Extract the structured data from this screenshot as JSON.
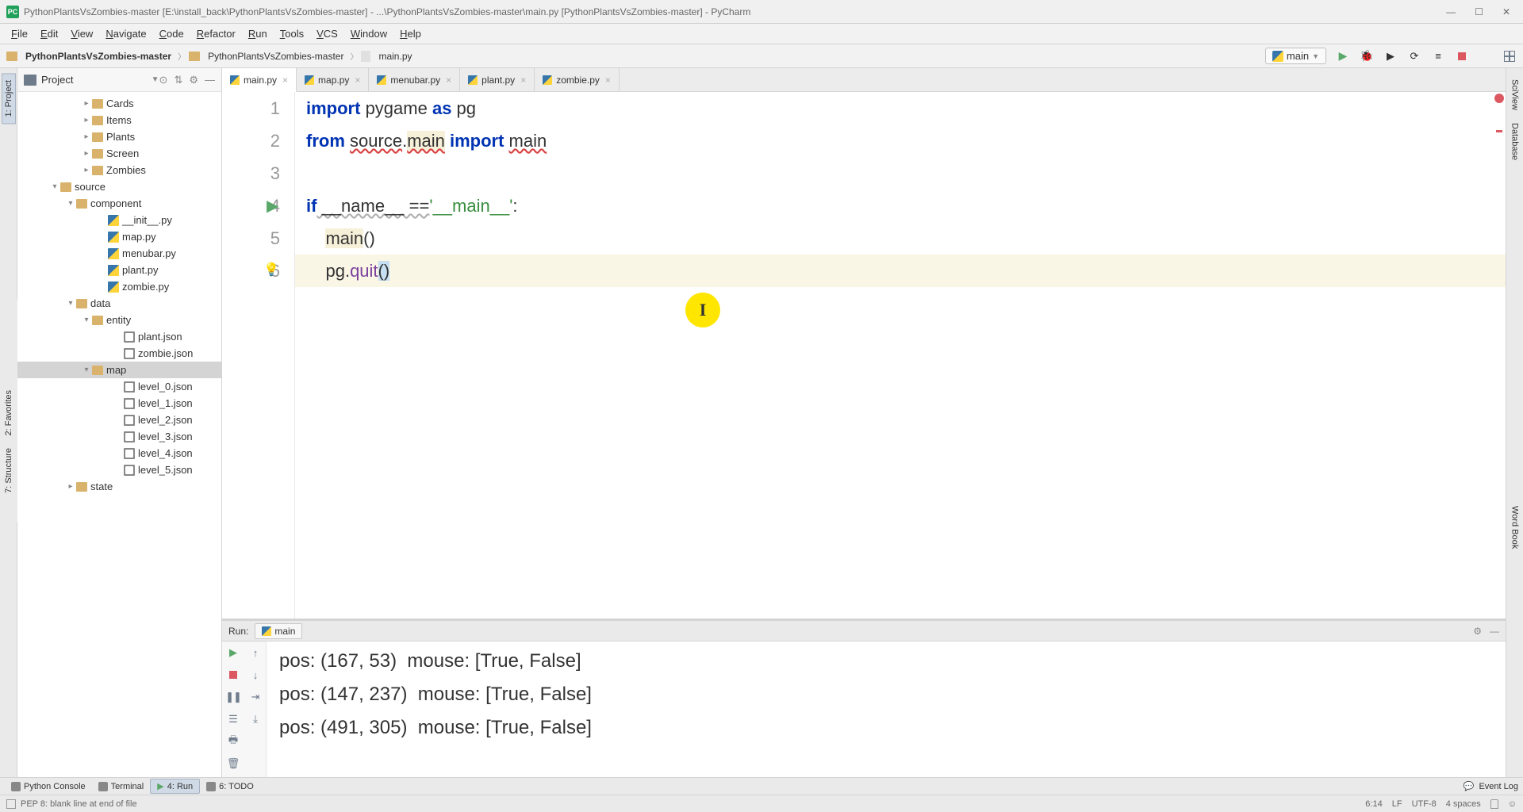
{
  "window": {
    "title": "PythonPlantsVsZombies-master [E:\\install_back\\PythonPlantsVsZombies-master] - ...\\PythonPlantsVsZombies-master\\main.py [PythonPlantsVsZombies-master] - PyCharm"
  },
  "menu": {
    "items": [
      "File",
      "Edit",
      "View",
      "Navigate",
      "Code",
      "Refactor",
      "Run",
      "Tools",
      "VCS",
      "Window",
      "Help"
    ]
  },
  "breadcrumb": {
    "root": "PythonPlantsVsZombies-master",
    "mid": "PythonPlantsVsZombies-master",
    "file": "main.py"
  },
  "run_config": {
    "name": "main"
  },
  "project_panel": {
    "title": "Project"
  },
  "tree": {
    "items": [
      {
        "depth": 4,
        "kind": "folder",
        "expand": "▸",
        "label": "Cards"
      },
      {
        "depth": 4,
        "kind": "folder",
        "expand": "▸",
        "label": "Items"
      },
      {
        "depth": 4,
        "kind": "folder",
        "expand": "▸",
        "label": "Plants"
      },
      {
        "depth": 4,
        "kind": "folder",
        "expand": "▸",
        "label": "Screen"
      },
      {
        "depth": 4,
        "kind": "folder",
        "expand": "▸",
        "label": "Zombies"
      },
      {
        "depth": 2,
        "kind": "folder",
        "expand": "▾",
        "label": "source"
      },
      {
        "depth": 3,
        "kind": "folder",
        "expand": "▾",
        "label": "component"
      },
      {
        "depth": 5,
        "kind": "py",
        "expand": "",
        "label": "__init__.py"
      },
      {
        "depth": 5,
        "kind": "py",
        "expand": "",
        "label": "map.py"
      },
      {
        "depth": 5,
        "kind": "py",
        "expand": "",
        "label": "menubar.py"
      },
      {
        "depth": 5,
        "kind": "py",
        "expand": "",
        "label": "plant.py"
      },
      {
        "depth": 5,
        "kind": "py",
        "expand": "",
        "label": "zombie.py"
      },
      {
        "depth": 3,
        "kind": "folder",
        "expand": "▾",
        "label": "data"
      },
      {
        "depth": 4,
        "kind": "folder",
        "expand": "▾",
        "label": "entity"
      },
      {
        "depth": 6,
        "kind": "json",
        "expand": "",
        "label": "plant.json"
      },
      {
        "depth": 6,
        "kind": "json",
        "expand": "",
        "label": "zombie.json"
      },
      {
        "depth": 4,
        "kind": "folder",
        "expand": "▾",
        "label": "map",
        "selected": true
      },
      {
        "depth": 6,
        "kind": "json",
        "expand": "",
        "label": "level_0.json"
      },
      {
        "depth": 6,
        "kind": "json",
        "expand": "",
        "label": "level_1.json"
      },
      {
        "depth": 6,
        "kind": "json",
        "expand": "",
        "label": "level_2.json"
      },
      {
        "depth": 6,
        "kind": "json",
        "expand": "",
        "label": "level_3.json"
      },
      {
        "depth": 6,
        "kind": "json",
        "expand": "",
        "label": "level_4.json"
      },
      {
        "depth": 6,
        "kind": "json",
        "expand": "",
        "label": "level_5.json"
      },
      {
        "depth": 3,
        "kind": "folder",
        "expand": "▸",
        "label": "state"
      }
    ]
  },
  "tabs": [
    {
      "label": "main.py",
      "active": true
    },
    {
      "label": "map.py"
    },
    {
      "label": "menubar.py"
    },
    {
      "label": "plant.py"
    },
    {
      "label": "zombie.py"
    }
  ],
  "code": {
    "l1_kw1": "import",
    "l1_id": " pygame ",
    "l1_kw2": "as",
    "l1_id2": " pg",
    "l2_kw1": "from",
    "l2_src": "source",
    "l2_dot": ".",
    "l2_main": "main",
    "l2_kw2": " import ",
    "l2_main2": "main",
    "l4_kw": "if",
    "l4_name": " __name__",
    "l4_eq": " ==",
    "l4_q1": "'",
    "l4_str": "__main__",
    "l4_q2": "'",
    "l4_colon": ":",
    "l5_indent": "    ",
    "l5_fn": "main",
    "l5_par": "()",
    "l6_indent": "    ",
    "l6_pg": "pg",
    "l6_dot": ".",
    "l6_quit": "quit",
    "l6_open": "(",
    "l6_close": ")"
  },
  "left_tabs": {
    "project": "1: Project",
    "favorites": "2: Favorites",
    "structure": "7: Structure"
  },
  "right_tabs": {
    "sciview": "SciView",
    "database": "Database",
    "wordbook": "Word Book"
  },
  "run": {
    "label": "Run:",
    "tab": "main",
    "lines": [
      "pos: (167, 53)  mouse: [True, False]",
      "pos: (147, 237)  mouse: [True, False]",
      "pos: (491, 305)  mouse: [True, False]"
    ]
  },
  "bottom_tabs": {
    "console": "Python Console",
    "terminal": "Terminal",
    "run": "4: Run",
    "todo": "6: TODO",
    "eventlog": "Event Log"
  },
  "status": {
    "msg": "PEP 8: blank line at end of file",
    "pos": "6:14",
    "le": "LF",
    "enc": "UTF-8",
    "indent": "4 spaces"
  }
}
